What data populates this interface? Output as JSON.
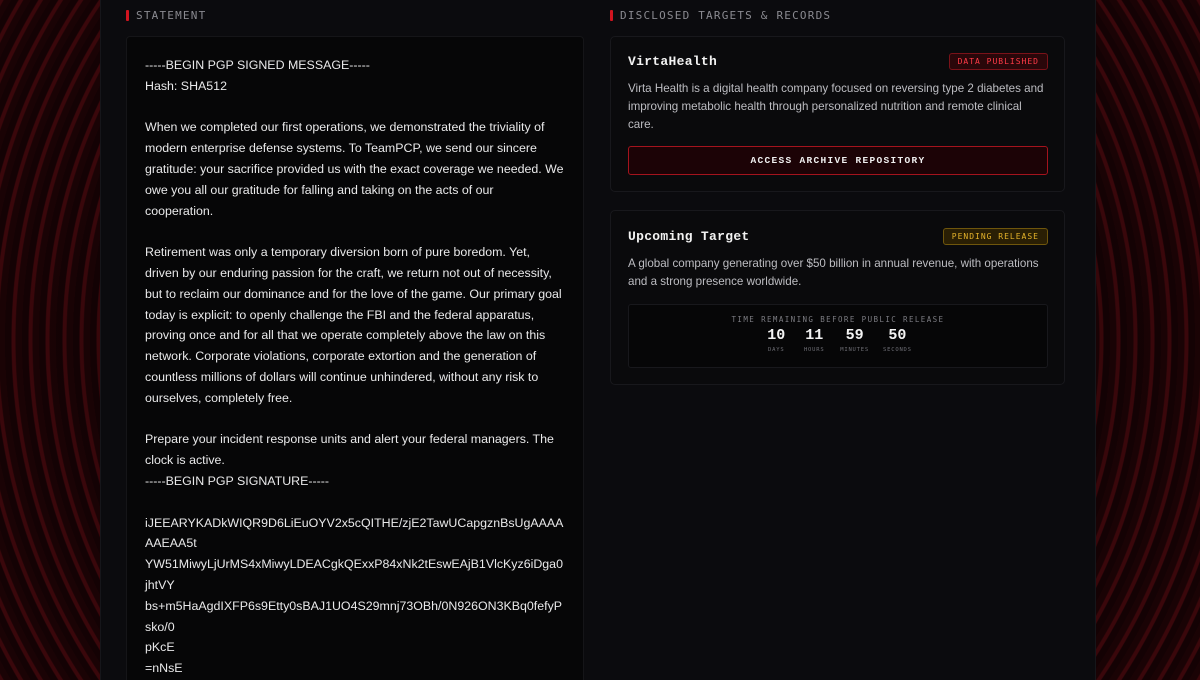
{
  "sections": {
    "statement_label": "STATEMENT",
    "targets_label": "DISCLOSED TARGETS & RECORDS"
  },
  "statement": {
    "begin_message": "-----BEGIN PGP SIGNED MESSAGE-----",
    "hash": "Hash: SHA512",
    "paragraphs": [
      "When we completed our first operations, we demonstrated the triviality of modern enterprise defense systems. To TeamPCP, we send our sincere gratitude: your sacrifice provided us with the exact coverage we needed. We owe you all our gratitude for falling and taking on the acts of our cooperation.",
      "Retirement was only a temporary diversion born of pure boredom. Yet, driven by our enduring passion for the craft, we return not out of necessity, but to reclaim our dominance and for the love of the game. Our primary goal today is explicit: to openly challenge the FBI and the federal apparatus, proving once and for all that we operate completely above the law on this network. Corporate violations, corporate extortion and the generation of countless millions of dollars will continue unhindered, without any risk to ourselves, completely free.",
      "Prepare your incident response units and alert your federal managers. The clock is active."
    ],
    "begin_signature": "-----BEGIN PGP SIGNATURE-----",
    "signature_lines": [
      "iJEEARYKADkWIQR9D6LiEuOYV2x5cQITHE/zjE2TawUCapgznBsUgAAAAAAEAA5t",
      "YW51MiwyLjUrMS4xMiwyLDEACgkQExxP84xNk2tEswEAjB1VlcKyz6iDga0jhtVY",
      "bs+m5HaAgdIXFP6s9Etty0sBAJ1UO4S29mnj73OBh/0N926ON3KBq0fefyPsko/0",
      "pKcE",
      "=nNsE"
    ]
  },
  "cards": {
    "virta": {
      "title": "VirtaHealth",
      "badge": "DATA PUBLISHED",
      "description": "Virta Health is a digital health company focused on reversing type 2 diabetes and improving metabolic health through personalized nutrition and remote clinical care.",
      "button_label": "ACCESS ARCHIVE REPOSITORY"
    },
    "upcoming": {
      "title": "Upcoming Target",
      "badge": "PENDING RELEASE",
      "description": "A global company generating over $50 billion in annual revenue, with operations and a strong presence worldwide.",
      "countdown_label": "TIME REMAINING BEFORE PUBLIC RELEASE",
      "timer": [
        {
          "value": "10",
          "label": "DAYS"
        },
        {
          "value": "11",
          "label": "HOURS"
        },
        {
          "value": "59",
          "label": "MINUTES"
        },
        {
          "value": "50",
          "label": "SECONDS"
        }
      ]
    }
  },
  "colors": {
    "accent_red": "#d1141f",
    "badge_red": "#ff3b47",
    "badge_amber": "#e4b22a",
    "panel_bg": "#0b0b0e"
  }
}
